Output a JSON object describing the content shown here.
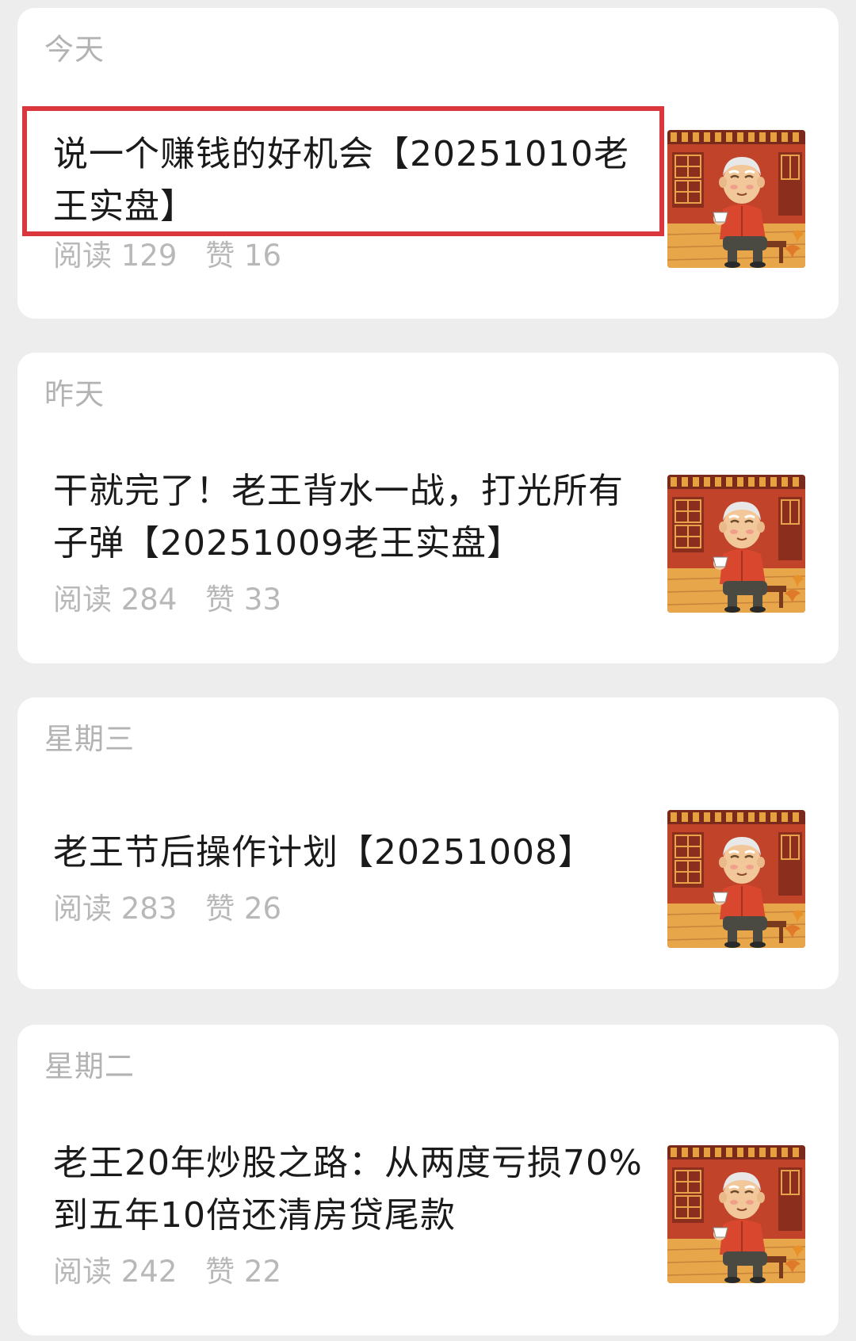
{
  "articles": [
    {
      "day": "今天",
      "title": "说一个赚钱的好机会【20251010老王实盘】",
      "reads_label": "阅读",
      "reads": "129",
      "likes_label": "赞",
      "likes": "16",
      "thumbnail_icon": "elderly-man-tea-illustration"
    },
    {
      "day": "昨天",
      "title": "干就完了！老王背水一战，打光所有子弹【20251009老王实盘】",
      "reads_label": "阅读",
      "reads": "284",
      "likes_label": "赞",
      "likes": "33",
      "thumbnail_icon": "elderly-man-tea-illustration"
    },
    {
      "day": "星期三",
      "title": "老王节后操作计划【20251008】",
      "reads_label": "阅读",
      "reads": "283",
      "likes_label": "赞",
      "likes": "26",
      "thumbnail_icon": "elderly-man-tea-illustration"
    },
    {
      "day": "星期二",
      "title": "老王20年炒股之路：从两度亏损70%到五年10倍还清房贷尾款",
      "reads_label": "阅读",
      "reads": "242",
      "likes_label": "赞",
      "likes": "22",
      "thumbnail_icon": "elderly-man-tea-illustration"
    }
  ],
  "colors": {
    "highlight": "#d9363e",
    "background": "#ededed",
    "card": "#ffffff",
    "muted_text": "#b3b3b3"
  }
}
